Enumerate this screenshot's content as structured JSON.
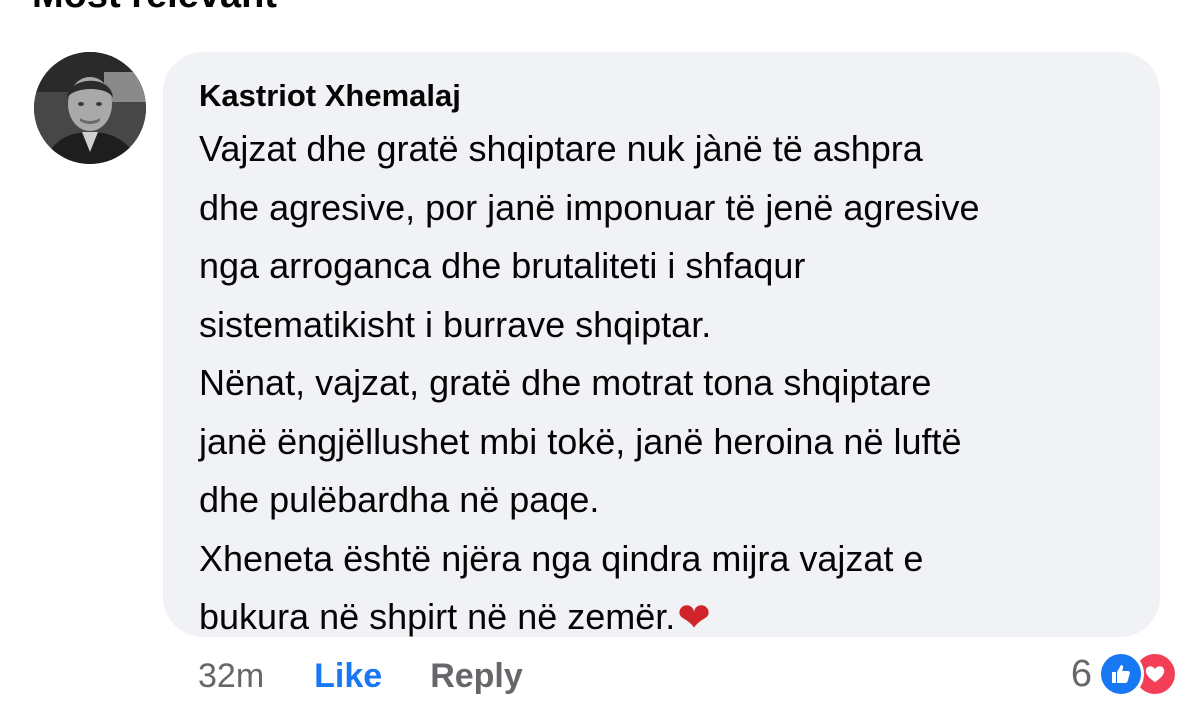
{
  "section": {
    "header": "Most relevant"
  },
  "comment": {
    "author": "Kastriot Xhemalaj",
    "text_lines": [
      "Vajzat dhe gratë shqiptare nuk jànë të ashpra",
      "dhe agresive, por janë imponuar të jenë agresive",
      "nga arroganca dhe brutaliteti i shfaqur",
      "sistematikisht i burrave shqiptar.",
      "Nënat, vajzat, gratë dhe motrat tona shqiptare",
      "janë ëngjëllushet mbi tokë, janë heroina në luftë",
      "dhe pulëbardha në paqe.",
      "Xheneta është njëra nga qindra mijra vajzat e",
      "bukura në shpirt në në zemër."
    ],
    "emoji": "❤",
    "timestamp": "32m",
    "like_label": "Like",
    "reply_label": "Reply",
    "reaction_count": "6",
    "reaction_icons": [
      "like-icon",
      "love-icon"
    ]
  },
  "colors": {
    "like_blue": "#1877f2",
    "love_red": "#f33e58",
    "bubble_bg": "#f0f2f5",
    "secondary_text": "#65676b"
  }
}
